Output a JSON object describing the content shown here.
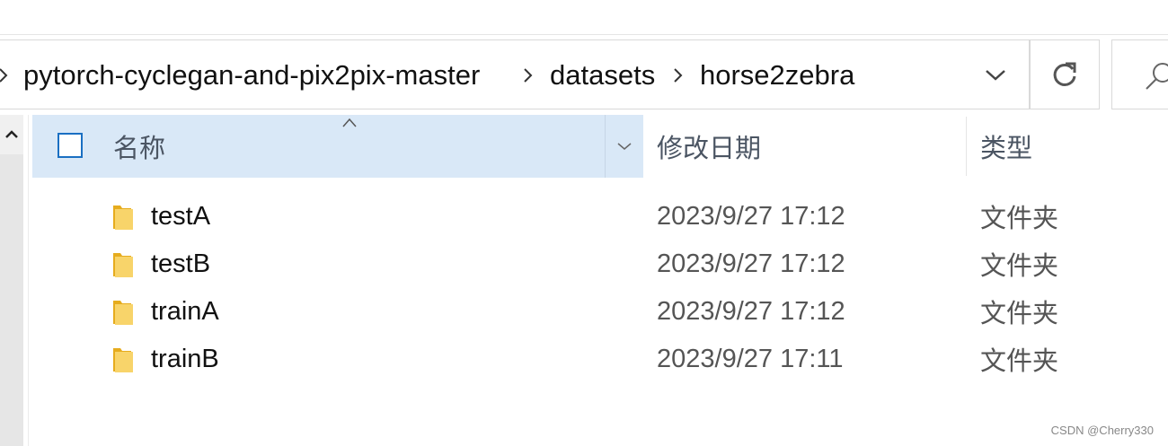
{
  "breadcrumb": {
    "items": [
      {
        "label": "pytorch-cyclegan-and-pix2pix-master"
      },
      {
        "label": "datasets"
      },
      {
        "label": "horse2zebra"
      }
    ]
  },
  "columns": {
    "name": "名称",
    "modified": "修改日期",
    "type": "类型"
  },
  "files": [
    {
      "name": "testA",
      "modified": "2023/9/27 17:12",
      "type": "文件夹"
    },
    {
      "name": "testB",
      "modified": "2023/9/27 17:12",
      "type": "文件夹"
    },
    {
      "name": "trainA",
      "modified": "2023/9/27 17:12",
      "type": "文件夹"
    },
    {
      "name": "trainB",
      "modified": "2023/9/27 17:11",
      "type": "文件夹"
    }
  ],
  "icons": {
    "folder": "folder-icon",
    "refresh": "refresh-icon",
    "search": "search-icon",
    "dropdown": "chevron-down-icon"
  },
  "colors": {
    "header_highlight": "#d9e8f7",
    "checkbox_border": "#1a6fc2",
    "folder": "#f5c542"
  },
  "watermark": "CSDN @Cherry330"
}
